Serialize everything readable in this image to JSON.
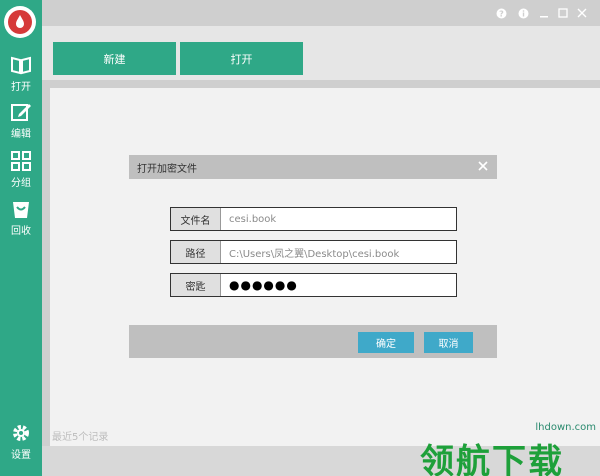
{
  "sidebar": {
    "items": [
      {
        "label": "打开",
        "icon": "book-icon"
      },
      {
        "label": "编辑",
        "icon": "edit-icon"
      },
      {
        "label": "分组",
        "icon": "grid-icon"
      },
      {
        "label": "回收",
        "icon": "recycle-bin-icon"
      }
    ],
    "settings": {
      "label": "设置",
      "icon": "gear-icon"
    }
  },
  "toolbar": {
    "new_label": "新建",
    "open_label": "打开"
  },
  "dialog": {
    "title": "打开加密文件",
    "fields": [
      {
        "label": "文件名",
        "value": "cesi.book"
      },
      {
        "label": "路径",
        "value": "C:\\Users\\凤之翼\\Desktop\\cesi.book"
      },
      {
        "label": "密匙",
        "value": "●●●●●●"
      }
    ],
    "confirm_label": "确定",
    "cancel_label": "取消"
  },
  "status": {
    "recent_text": "最近5个记录"
  },
  "watermark": {
    "url": "lhdown.com",
    "text": "领航下载"
  },
  "colors": {
    "accent": "#2fa887",
    "dialog_button": "#3fa9c9",
    "logo_red": "#d63a3a"
  }
}
